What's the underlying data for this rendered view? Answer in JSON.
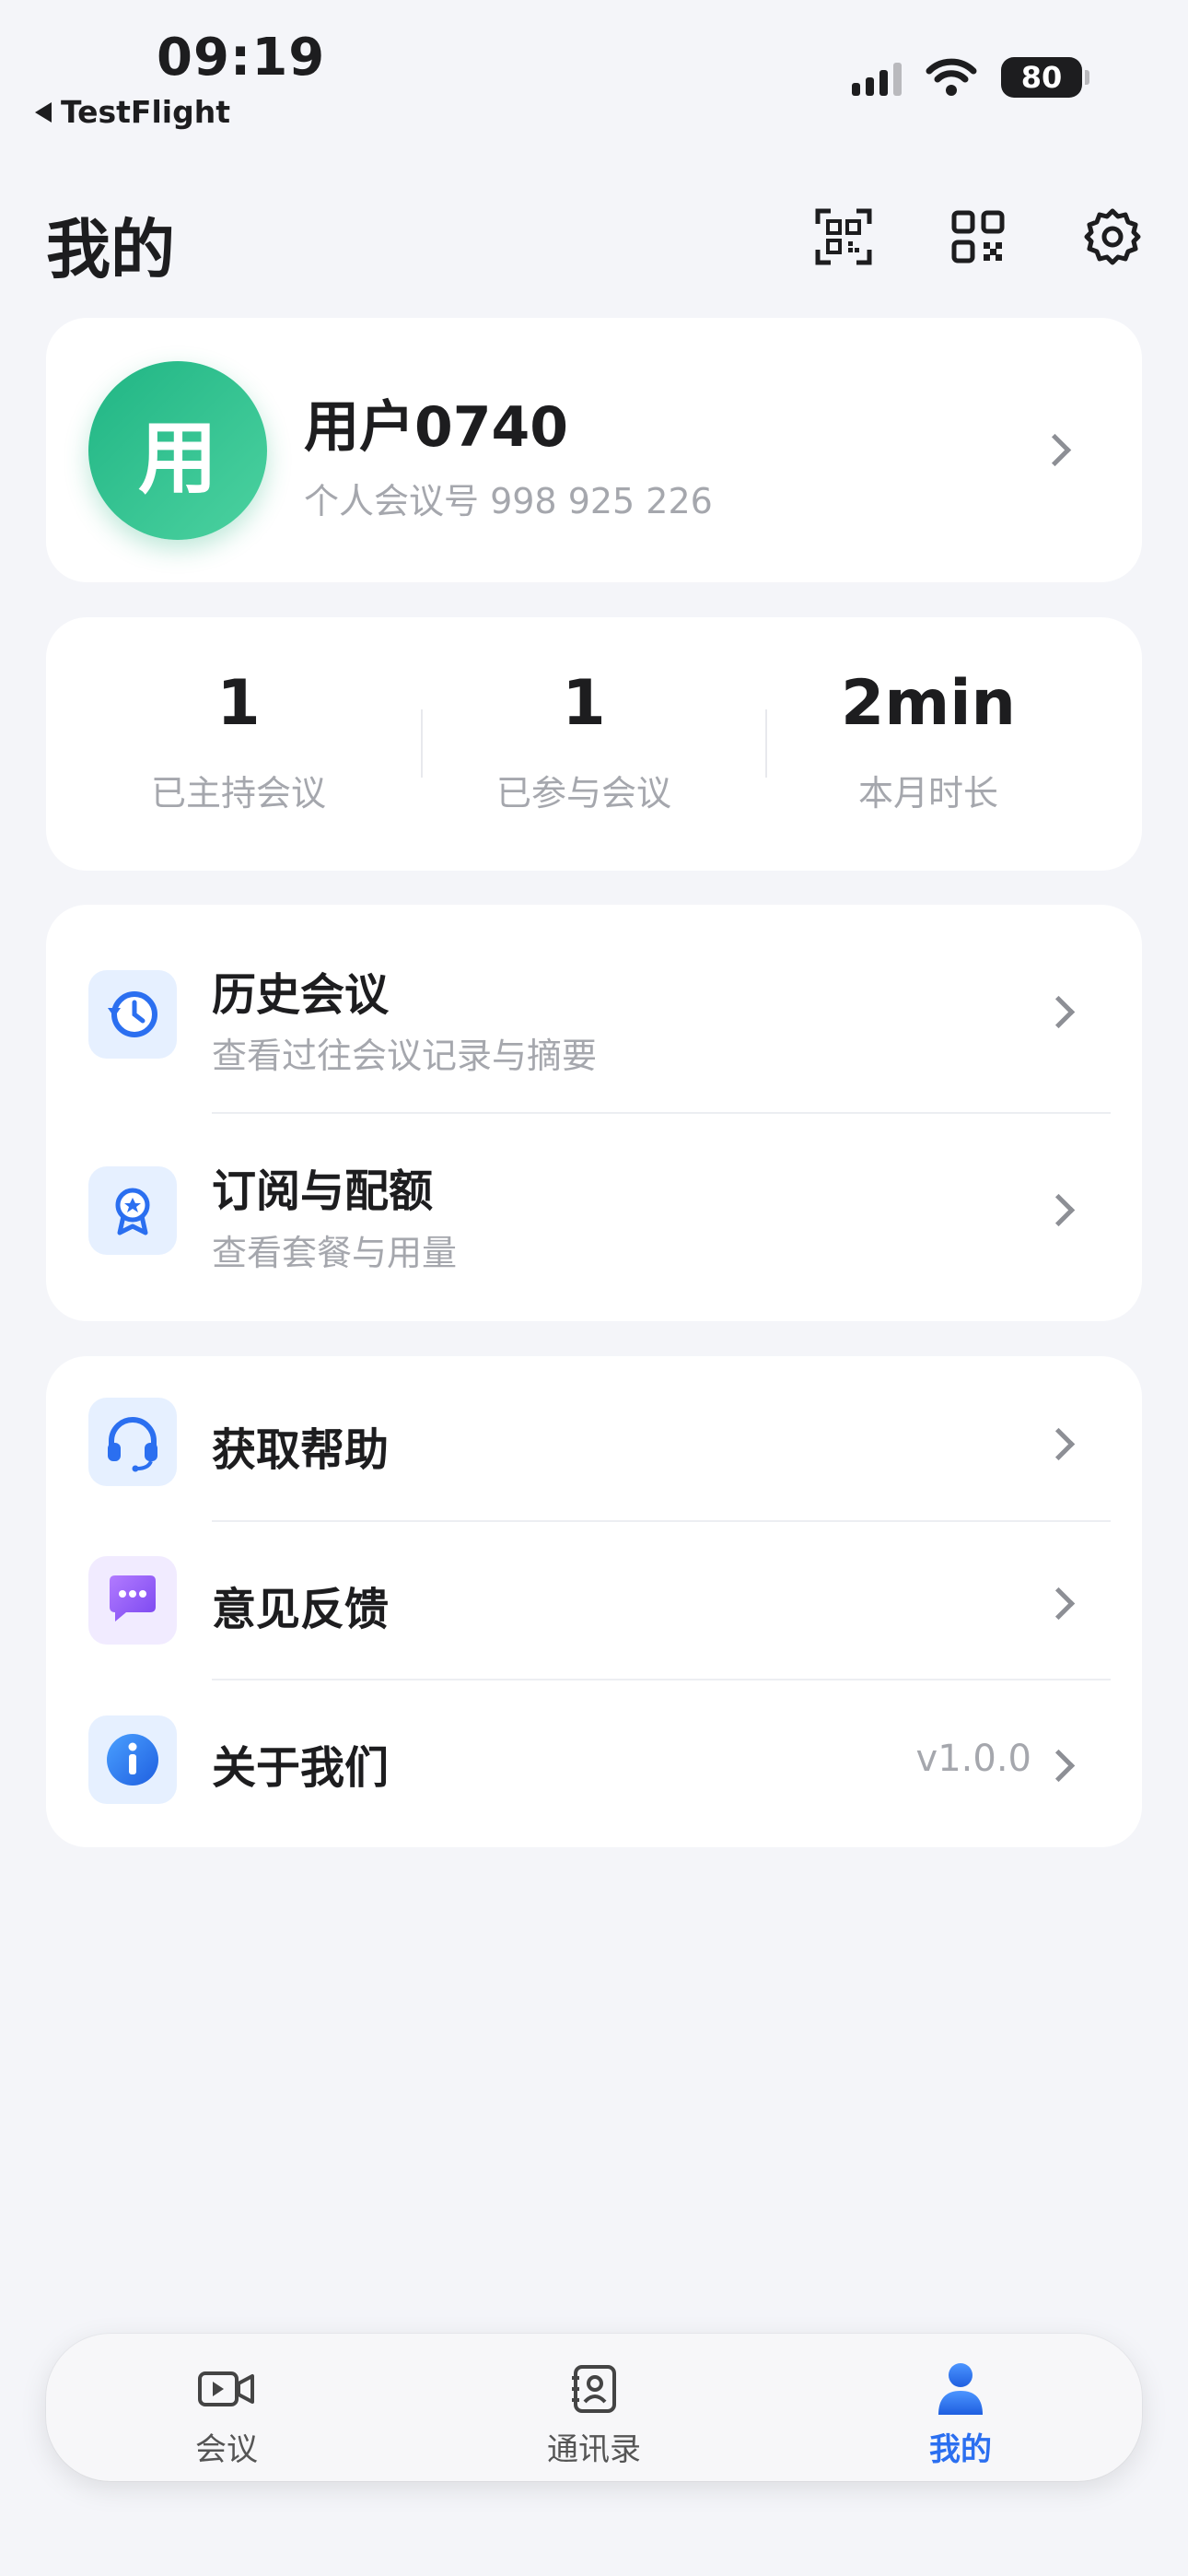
{
  "status_bar": {
    "time": "09:19",
    "back_app": "TestFlight",
    "battery": "80"
  },
  "header": {
    "title": "我的",
    "icons": [
      "scan-icon",
      "qr-code-icon",
      "gear-icon"
    ]
  },
  "profile": {
    "avatar_char": "用",
    "name": "用户0740",
    "meeting_id": "个人会议号 998 925 226"
  },
  "stats": [
    {
      "value": "1",
      "label": "已主持会议"
    },
    {
      "value": "1",
      "label": "已参与会议"
    },
    {
      "value": "2min",
      "label": "本月时长"
    }
  ],
  "menu_group_1": [
    {
      "title": "历史会议",
      "subtitle": "查看过往会议记录与摘要",
      "icon": "history-icon"
    },
    {
      "title": "订阅与配额",
      "subtitle": "查看套餐与用量",
      "icon": "badge-icon"
    }
  ],
  "menu_group_2": [
    {
      "title": "获取帮助",
      "icon": "headset-icon"
    },
    {
      "title": "意见反馈",
      "icon": "chat-icon"
    },
    {
      "title": "关于我们",
      "icon": "info-icon",
      "value": "v1.0.0"
    }
  ],
  "tabbar": {
    "tabs": [
      {
        "label": "会议",
        "icon": "video-icon"
      },
      {
        "label": "通讯录",
        "icon": "contacts-icon"
      },
      {
        "label": "我的",
        "icon": "person-icon",
        "active": true
      }
    ]
  },
  "colors": {
    "background": "#f4f5f9",
    "accent": "#2b6ff0",
    "avatar_green": "#2cc08e"
  }
}
